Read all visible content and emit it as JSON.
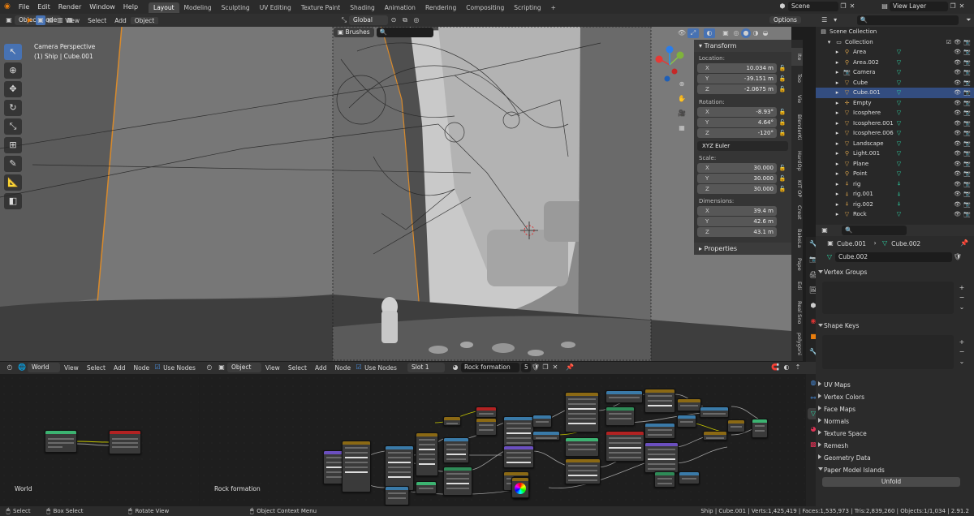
{
  "app": {
    "menu": [
      "File",
      "Edit",
      "Render",
      "Window",
      "Help"
    ],
    "workspaces": [
      "Layout",
      "Modeling",
      "Sculpting",
      "UV Editing",
      "Texture Paint",
      "Shading",
      "Animation",
      "Rendering",
      "Compositing",
      "Scripting"
    ],
    "active_workspace": "Layout",
    "add_tab": "+",
    "scene": "Scene",
    "view_layer": "View Layer",
    "accent": "#4772b3"
  },
  "viewport": {
    "mode": "Object Mode",
    "menus": [
      "View",
      "Select",
      "Add",
      "Object"
    ],
    "transform_orientation": "Global",
    "brushes": "Brushes",
    "options": "Options",
    "overlay_title": "Camera Perspective",
    "overlay_subtitle": "(1) Ship | Cube.001"
  },
  "npanel": {
    "transform": "Transform",
    "location_label": "Location:",
    "location": [
      {
        "axis": "X",
        "value": "10.034 m"
      },
      {
        "axis": "Y",
        "value": "-39.151 m"
      },
      {
        "axis": "Z",
        "value": "-2.0675 m"
      }
    ],
    "rotation_label": "Rotation:",
    "rotation": [
      {
        "axis": "X",
        "value": "-8.93°"
      },
      {
        "axis": "Y",
        "value": "4.64°"
      },
      {
        "axis": "Z",
        "value": "-120°"
      }
    ],
    "rotation_mode": "XYZ Euler",
    "scale_label": "Scale:",
    "scale": [
      {
        "axis": "X",
        "value": "30.000"
      },
      {
        "axis": "Y",
        "value": "30.000"
      },
      {
        "axis": "Z",
        "value": "30.000"
      }
    ],
    "dimensions_label": "Dimensions:",
    "dimensions": [
      {
        "axis": "X",
        "value": "39.4 m"
      },
      {
        "axis": "Y",
        "value": "42.6 m"
      },
      {
        "axis": "Z",
        "value": "43.1 m"
      }
    ],
    "properties": "Properties",
    "side_tabs": [
      "Ite",
      "Too",
      "Vie",
      "BlenderKi",
      "HardOp",
      "KIT OP",
      "Creat",
      "BakeLa",
      "Pape",
      "Edi",
      "Real Sno",
      "polygoni"
    ]
  },
  "outliner": {
    "scene_collection": "Scene Collection",
    "collection": "Collection",
    "items": [
      {
        "name": "Area",
        "icon": "light",
        "color": "#d9a24a"
      },
      {
        "name": "Area.002",
        "icon": "light",
        "color": "#d9a24a"
      },
      {
        "name": "Camera",
        "icon": "camera",
        "color": "#d9a24a"
      },
      {
        "name": "Cube",
        "icon": "mesh",
        "color": "#d9a24a"
      },
      {
        "name": "Cube.001",
        "icon": "mesh",
        "color": "#d9a24a",
        "selected": true
      },
      {
        "name": "Empty",
        "icon": "empty",
        "color": "#d9a24a"
      },
      {
        "name": "Icosphere",
        "icon": "mesh",
        "color": "#d9a24a"
      },
      {
        "name": "Icosphere.001",
        "icon": "mesh",
        "color": "#d9a24a"
      },
      {
        "name": "Icosphere.006",
        "icon": "mesh",
        "color": "#d9a24a"
      },
      {
        "name": "Landscape",
        "icon": "mesh",
        "color": "#d9a24a"
      },
      {
        "name": "Light.001",
        "icon": "light",
        "color": "#d9a24a"
      },
      {
        "name": "Plane",
        "icon": "mesh",
        "color": "#d9a24a"
      },
      {
        "name": "Point",
        "icon": "light",
        "color": "#d9a24a"
      },
      {
        "name": "rig",
        "icon": "armature",
        "color": "#d9a24a"
      },
      {
        "name": "rig.001",
        "icon": "armature",
        "color": "#d9a24a"
      },
      {
        "name": "rig.002",
        "icon": "armature",
        "color": "#d9a24a"
      },
      {
        "name": "Rock",
        "icon": "mesh",
        "color": "#d9a24a"
      }
    ]
  },
  "properties": {
    "object": "Cube.001",
    "mesh": "Cube.002",
    "mesh_field": "Cube.002",
    "sections_open": [
      "Vertex Groups",
      "Shape Keys"
    ],
    "sections_closed": [
      "UV Maps",
      "Vertex Colors",
      "Face Maps",
      "Normals",
      "Texture Space",
      "Remesh",
      "Geometry Data",
      "Paper Model Islands"
    ],
    "unfold": "Unfold"
  },
  "node_left": {
    "type": "World",
    "menus": [
      "View",
      "Select",
      "Add",
      "Node"
    ],
    "use_nodes": "Use Nodes",
    "label": "World"
  },
  "node_right": {
    "type": "Object",
    "menus": [
      "View",
      "Select",
      "Add",
      "Node"
    ],
    "use_nodes": "Use Nodes",
    "slot": "Slot 1",
    "material": "Rock formation",
    "users": "5",
    "label": "Rock formation"
  },
  "status": {
    "left": [
      {
        "key": "Select"
      },
      {
        "key": "Box Select"
      },
      {
        "key": "Rotate View"
      },
      {
        "key": "Object Context Menu"
      }
    ],
    "right": "Ship | Cube.001 | Verts:1,425,419 | Faces:1,535,973 | Tris:2,839,260 | Objects:1/1,034 | 2.91.2"
  }
}
